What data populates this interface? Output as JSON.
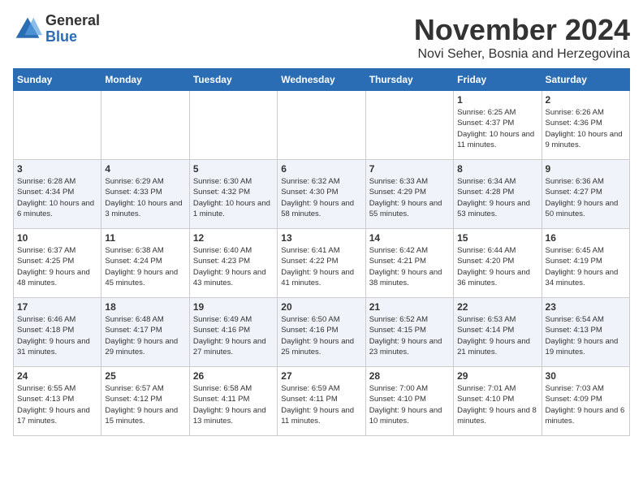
{
  "header": {
    "logo_general": "General",
    "logo_blue": "Blue",
    "month_title": "November 2024",
    "subtitle": "Novi Seher, Bosnia and Herzegovina"
  },
  "days_of_week": [
    "Sunday",
    "Monday",
    "Tuesday",
    "Wednesday",
    "Thursday",
    "Friday",
    "Saturday"
  ],
  "weeks": [
    [
      {
        "day": "",
        "info": ""
      },
      {
        "day": "",
        "info": ""
      },
      {
        "day": "",
        "info": ""
      },
      {
        "day": "",
        "info": ""
      },
      {
        "day": "",
        "info": ""
      },
      {
        "day": "1",
        "info": "Sunrise: 6:25 AM\nSunset: 4:37 PM\nDaylight: 10 hours and 11 minutes."
      },
      {
        "day": "2",
        "info": "Sunrise: 6:26 AM\nSunset: 4:36 PM\nDaylight: 10 hours and 9 minutes."
      }
    ],
    [
      {
        "day": "3",
        "info": "Sunrise: 6:28 AM\nSunset: 4:34 PM\nDaylight: 10 hours and 6 minutes."
      },
      {
        "day": "4",
        "info": "Sunrise: 6:29 AM\nSunset: 4:33 PM\nDaylight: 10 hours and 3 minutes."
      },
      {
        "day": "5",
        "info": "Sunrise: 6:30 AM\nSunset: 4:32 PM\nDaylight: 10 hours and 1 minute."
      },
      {
        "day": "6",
        "info": "Sunrise: 6:32 AM\nSunset: 4:30 PM\nDaylight: 9 hours and 58 minutes."
      },
      {
        "day": "7",
        "info": "Sunrise: 6:33 AM\nSunset: 4:29 PM\nDaylight: 9 hours and 55 minutes."
      },
      {
        "day": "8",
        "info": "Sunrise: 6:34 AM\nSunset: 4:28 PM\nDaylight: 9 hours and 53 minutes."
      },
      {
        "day": "9",
        "info": "Sunrise: 6:36 AM\nSunset: 4:27 PM\nDaylight: 9 hours and 50 minutes."
      }
    ],
    [
      {
        "day": "10",
        "info": "Sunrise: 6:37 AM\nSunset: 4:25 PM\nDaylight: 9 hours and 48 minutes."
      },
      {
        "day": "11",
        "info": "Sunrise: 6:38 AM\nSunset: 4:24 PM\nDaylight: 9 hours and 45 minutes."
      },
      {
        "day": "12",
        "info": "Sunrise: 6:40 AM\nSunset: 4:23 PM\nDaylight: 9 hours and 43 minutes."
      },
      {
        "day": "13",
        "info": "Sunrise: 6:41 AM\nSunset: 4:22 PM\nDaylight: 9 hours and 41 minutes."
      },
      {
        "day": "14",
        "info": "Sunrise: 6:42 AM\nSunset: 4:21 PM\nDaylight: 9 hours and 38 minutes."
      },
      {
        "day": "15",
        "info": "Sunrise: 6:44 AM\nSunset: 4:20 PM\nDaylight: 9 hours and 36 minutes."
      },
      {
        "day": "16",
        "info": "Sunrise: 6:45 AM\nSunset: 4:19 PM\nDaylight: 9 hours and 34 minutes."
      }
    ],
    [
      {
        "day": "17",
        "info": "Sunrise: 6:46 AM\nSunset: 4:18 PM\nDaylight: 9 hours and 31 minutes."
      },
      {
        "day": "18",
        "info": "Sunrise: 6:48 AM\nSunset: 4:17 PM\nDaylight: 9 hours and 29 minutes."
      },
      {
        "day": "19",
        "info": "Sunrise: 6:49 AM\nSunset: 4:16 PM\nDaylight: 9 hours and 27 minutes."
      },
      {
        "day": "20",
        "info": "Sunrise: 6:50 AM\nSunset: 4:16 PM\nDaylight: 9 hours and 25 minutes."
      },
      {
        "day": "21",
        "info": "Sunrise: 6:52 AM\nSunset: 4:15 PM\nDaylight: 9 hours and 23 minutes."
      },
      {
        "day": "22",
        "info": "Sunrise: 6:53 AM\nSunset: 4:14 PM\nDaylight: 9 hours and 21 minutes."
      },
      {
        "day": "23",
        "info": "Sunrise: 6:54 AM\nSunset: 4:13 PM\nDaylight: 9 hours and 19 minutes."
      }
    ],
    [
      {
        "day": "24",
        "info": "Sunrise: 6:55 AM\nSunset: 4:13 PM\nDaylight: 9 hours and 17 minutes."
      },
      {
        "day": "25",
        "info": "Sunrise: 6:57 AM\nSunset: 4:12 PM\nDaylight: 9 hours and 15 minutes."
      },
      {
        "day": "26",
        "info": "Sunrise: 6:58 AM\nSunset: 4:11 PM\nDaylight: 9 hours and 13 minutes."
      },
      {
        "day": "27",
        "info": "Sunrise: 6:59 AM\nSunset: 4:11 PM\nDaylight: 9 hours and 11 minutes."
      },
      {
        "day": "28",
        "info": "Sunrise: 7:00 AM\nSunset: 4:10 PM\nDaylight: 9 hours and 10 minutes."
      },
      {
        "day": "29",
        "info": "Sunrise: 7:01 AM\nSunset: 4:10 PM\nDaylight: 9 hours and 8 minutes."
      },
      {
        "day": "30",
        "info": "Sunrise: 7:03 AM\nSunset: 4:09 PM\nDaylight: 9 hours and 6 minutes."
      }
    ]
  ]
}
